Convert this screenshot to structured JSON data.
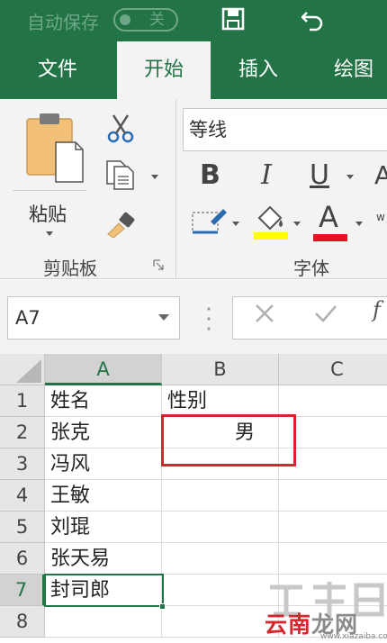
{
  "titlebar": {
    "autosave_label": "自动保存",
    "autosave_state": "关"
  },
  "tabs": [
    {
      "label": "文件",
      "active": false
    },
    {
      "label": "开始",
      "active": true
    },
    {
      "label": "插入",
      "active": false
    },
    {
      "label": "绘图",
      "active": false
    }
  ],
  "ribbon": {
    "paste_label": "粘贴",
    "clipboard_group": "剪贴板",
    "font_group": "字体",
    "font_name": "等线",
    "bold": "B",
    "italic": "I",
    "underline": "U",
    "font_color_glyph": "A",
    "grow_font_glyph": "A",
    "highlight_color": "#ffff00",
    "font_color": "#e81123"
  },
  "formula_bar": {
    "name_box": "A7",
    "fx_label": "f"
  },
  "grid": {
    "columns": [
      "A",
      "B",
      "C"
    ],
    "selected_column": "A",
    "rows": [
      "1",
      "2",
      "3",
      "4",
      "5",
      "6",
      "7",
      "8"
    ],
    "selected_row": "7",
    "cells": [
      [
        "姓名",
        "性别",
        ""
      ],
      [
        "张克",
        "男",
        ""
      ],
      [
        "冯风",
        "",
        ""
      ],
      [
        "王敏",
        "",
        ""
      ],
      [
        "刘琨",
        "",
        ""
      ],
      [
        "张天易",
        "",
        ""
      ],
      [
        "封司郎",
        "",
        ""
      ],
      [
        "",
        "",
        ""
      ]
    ]
  },
  "watermark": {
    "brand_a": "云南",
    "brand_b": "龙网",
    "url": "www.xiazaiba.com"
  },
  "colors": {
    "accent": "#227446",
    "annotation": "#d9232d"
  }
}
